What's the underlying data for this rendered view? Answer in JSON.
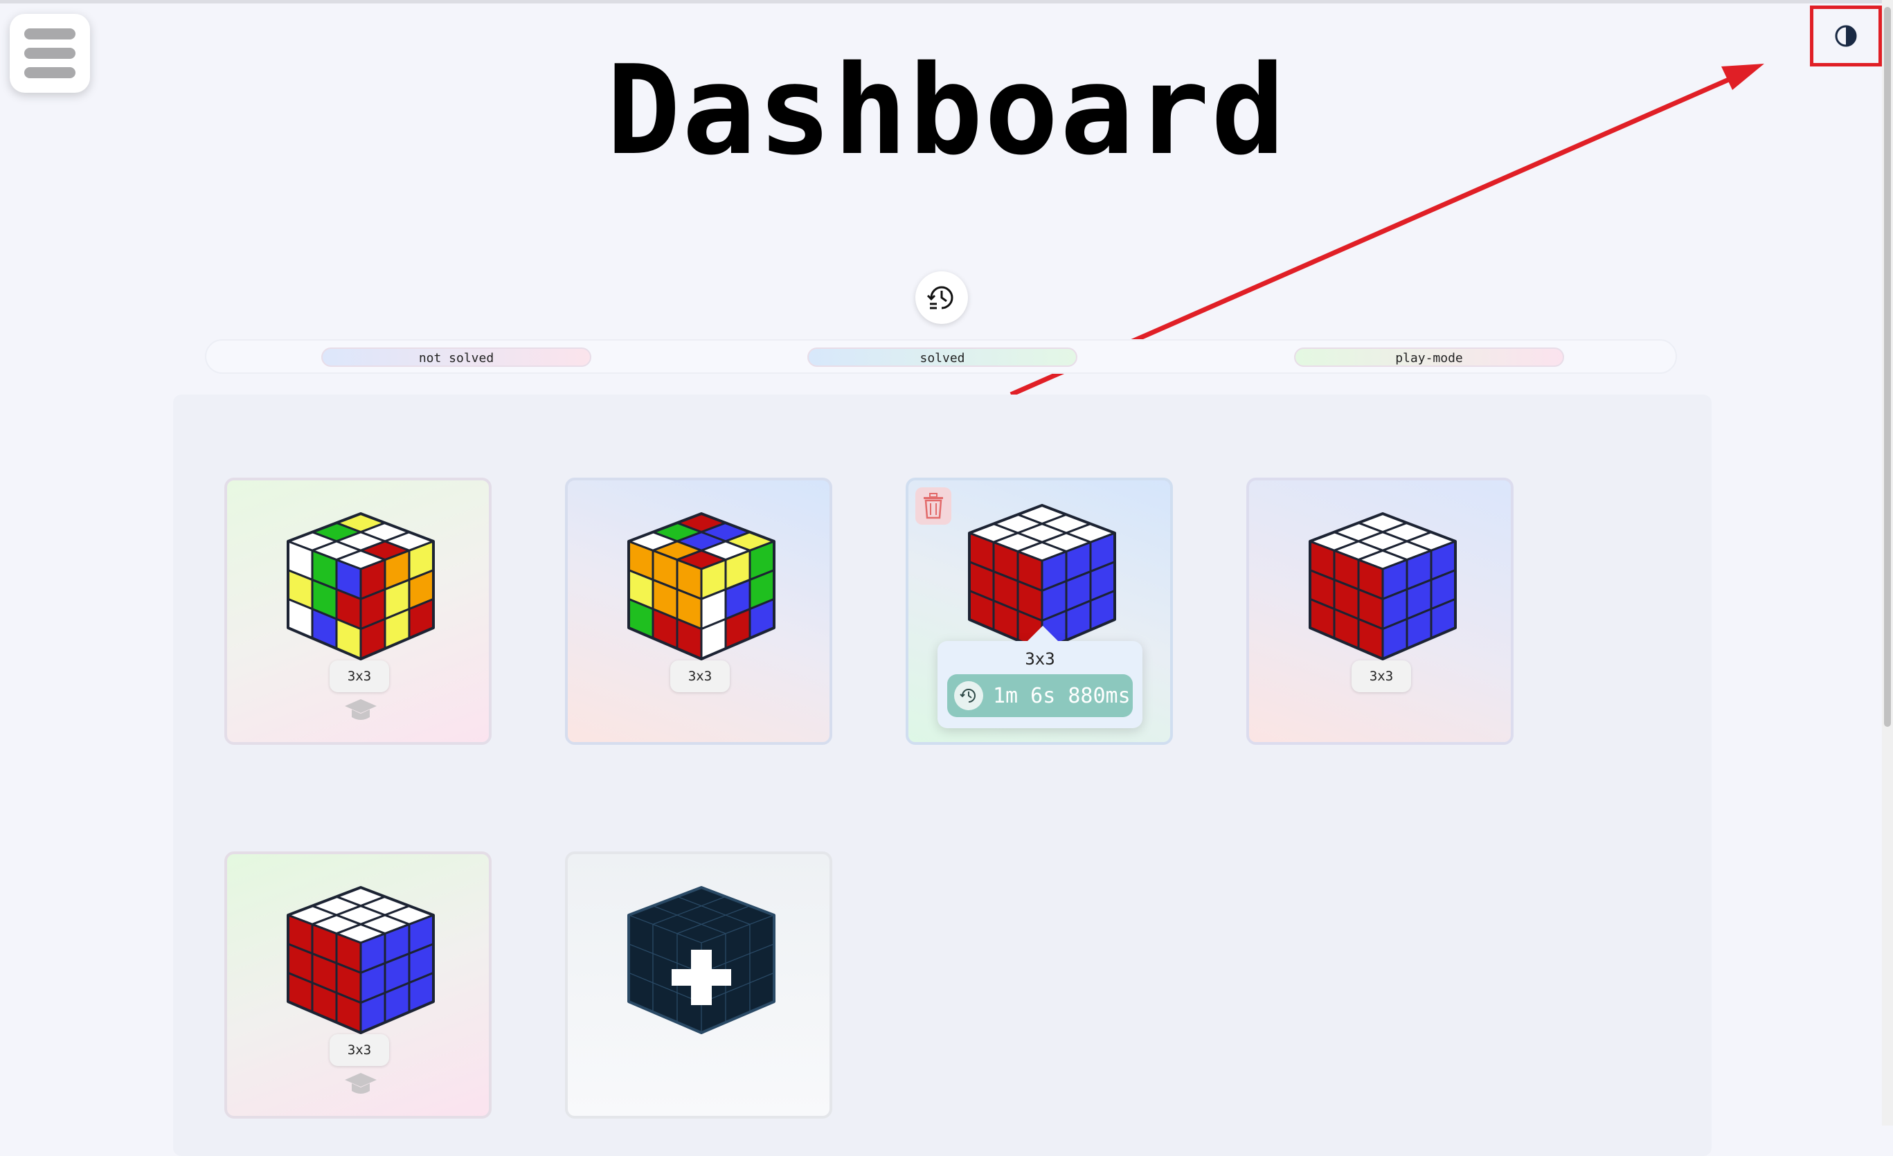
{
  "page": {
    "title": "Dashboard"
  },
  "filters": [
    {
      "label": "not solved"
    },
    {
      "label": "solved"
    },
    {
      "label": "play-mode"
    }
  ],
  "cards": [
    {
      "size": "3x3",
      "state": "scrambled",
      "mode_icon": "graduation-cap-icon"
    },
    {
      "size": "3x3",
      "state": "scrambled"
    },
    {
      "size": "3x3",
      "state": "solved",
      "deletable": true
    },
    {
      "size": "3x3",
      "state": "solved"
    },
    {
      "size": "3x3",
      "state": "solved",
      "mode_icon": "graduation-cap-icon"
    }
  ],
  "add_card": {
    "icon": "add-cube-icon"
  },
  "tooltip": {
    "size": "3x3",
    "time": "1m 6s 880ms"
  },
  "icons": {
    "menu": "hamburger-menu-icon",
    "theme": "contrast-toggle-icon",
    "history": "history-icon",
    "delete": "trash-icon",
    "clock": "clock-icon"
  },
  "colors": {
    "annotation_red": "#e01f26",
    "cube_red": "#c40d0d",
    "cube_blue": "#3b3bf0",
    "cube_green": "#1fbf1f",
    "cube_yellow": "#f4f44e",
    "cube_orange": "#f6a000",
    "cube_white": "#ffffff",
    "timer_chip": "#8cc8be"
  }
}
